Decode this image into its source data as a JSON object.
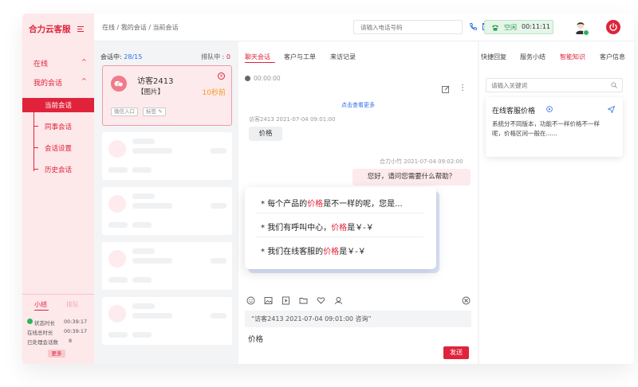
{
  "app": {
    "brand": "合力云客服"
  },
  "sidebar": {
    "items": [
      {
        "label": "在线",
        "chevron": "^"
      },
      {
        "label": "我的会话",
        "chevron": "^"
      },
      {
        "label": "当前会话"
      },
      {
        "label": "同事会话"
      },
      {
        "label": "会话设置"
      },
      {
        "label": "历史会话"
      }
    ],
    "summary_tabs": [
      "小结",
      "排队"
    ],
    "stats": [
      {
        "label": "状态时长",
        "value": "00:39:17"
      },
      {
        "label": "在线总时长",
        "value": "00:39:17"
      },
      {
        "label": "已处理会话数",
        "value": "8"
      }
    ],
    "more": "更多"
  },
  "header": {
    "breadcrumb": "在线 / 我的会话 / 当前会话",
    "phone_placeholder": "请输入电话号码",
    "status": "空闲",
    "timer": "00:11:11",
    "colors": {
      "accent": "#e0233b",
      "status_green": "#2fa14d"
    }
  },
  "conversations": {
    "active_label": "会话中:",
    "active_count": "28",
    "total_count": "/15",
    "queue_label": "排队中 :",
    "queue_count": "0",
    "current": {
      "name": "访客2413",
      "preview": "【图片】",
      "time": "10秒前",
      "tags": [
        "微信入口",
        "标签"
      ]
    }
  },
  "chat": {
    "tabs": [
      "聊天会话",
      "客户与工单",
      "来访记录"
    ],
    "duration": "00:00:00",
    "load_more": "点击查看更多",
    "messages": [
      {
        "sender": "访客2413",
        "time": "2021-07-04 09:01:00",
        "text": "价格"
      },
      {
        "sender": "合力小竹",
        "time": "2021-07-04 09:02:00",
        "text": "您好，请问您需要什么帮助？"
      }
    ],
    "suggestions": [
      {
        "pre": "每个产品的",
        "hl": "价格",
        "post": "是不一样的呢，您是..."
      },
      {
        "pre": "我们有呼叫中心，",
        "hl": "价格",
        "post": "是￥-￥"
      },
      {
        "pre": "我们在线客服的",
        "hl": "价格",
        "post": "是￥-￥"
      }
    ],
    "quote": "“访客2413 2021-07-04 09:01:00 咨询”",
    "input": "价格",
    "send": "发送"
  },
  "right": {
    "tabs": [
      "快捷回复",
      "服务小结",
      "智能知识",
      "客户信息"
    ],
    "active_tab": 2,
    "search_placeholder": "请输入关键词",
    "card": {
      "title": "在线客服价格",
      "body": "系统分不同版本，功能不一样价格不一样呢，价格区间一般在......"
    }
  }
}
